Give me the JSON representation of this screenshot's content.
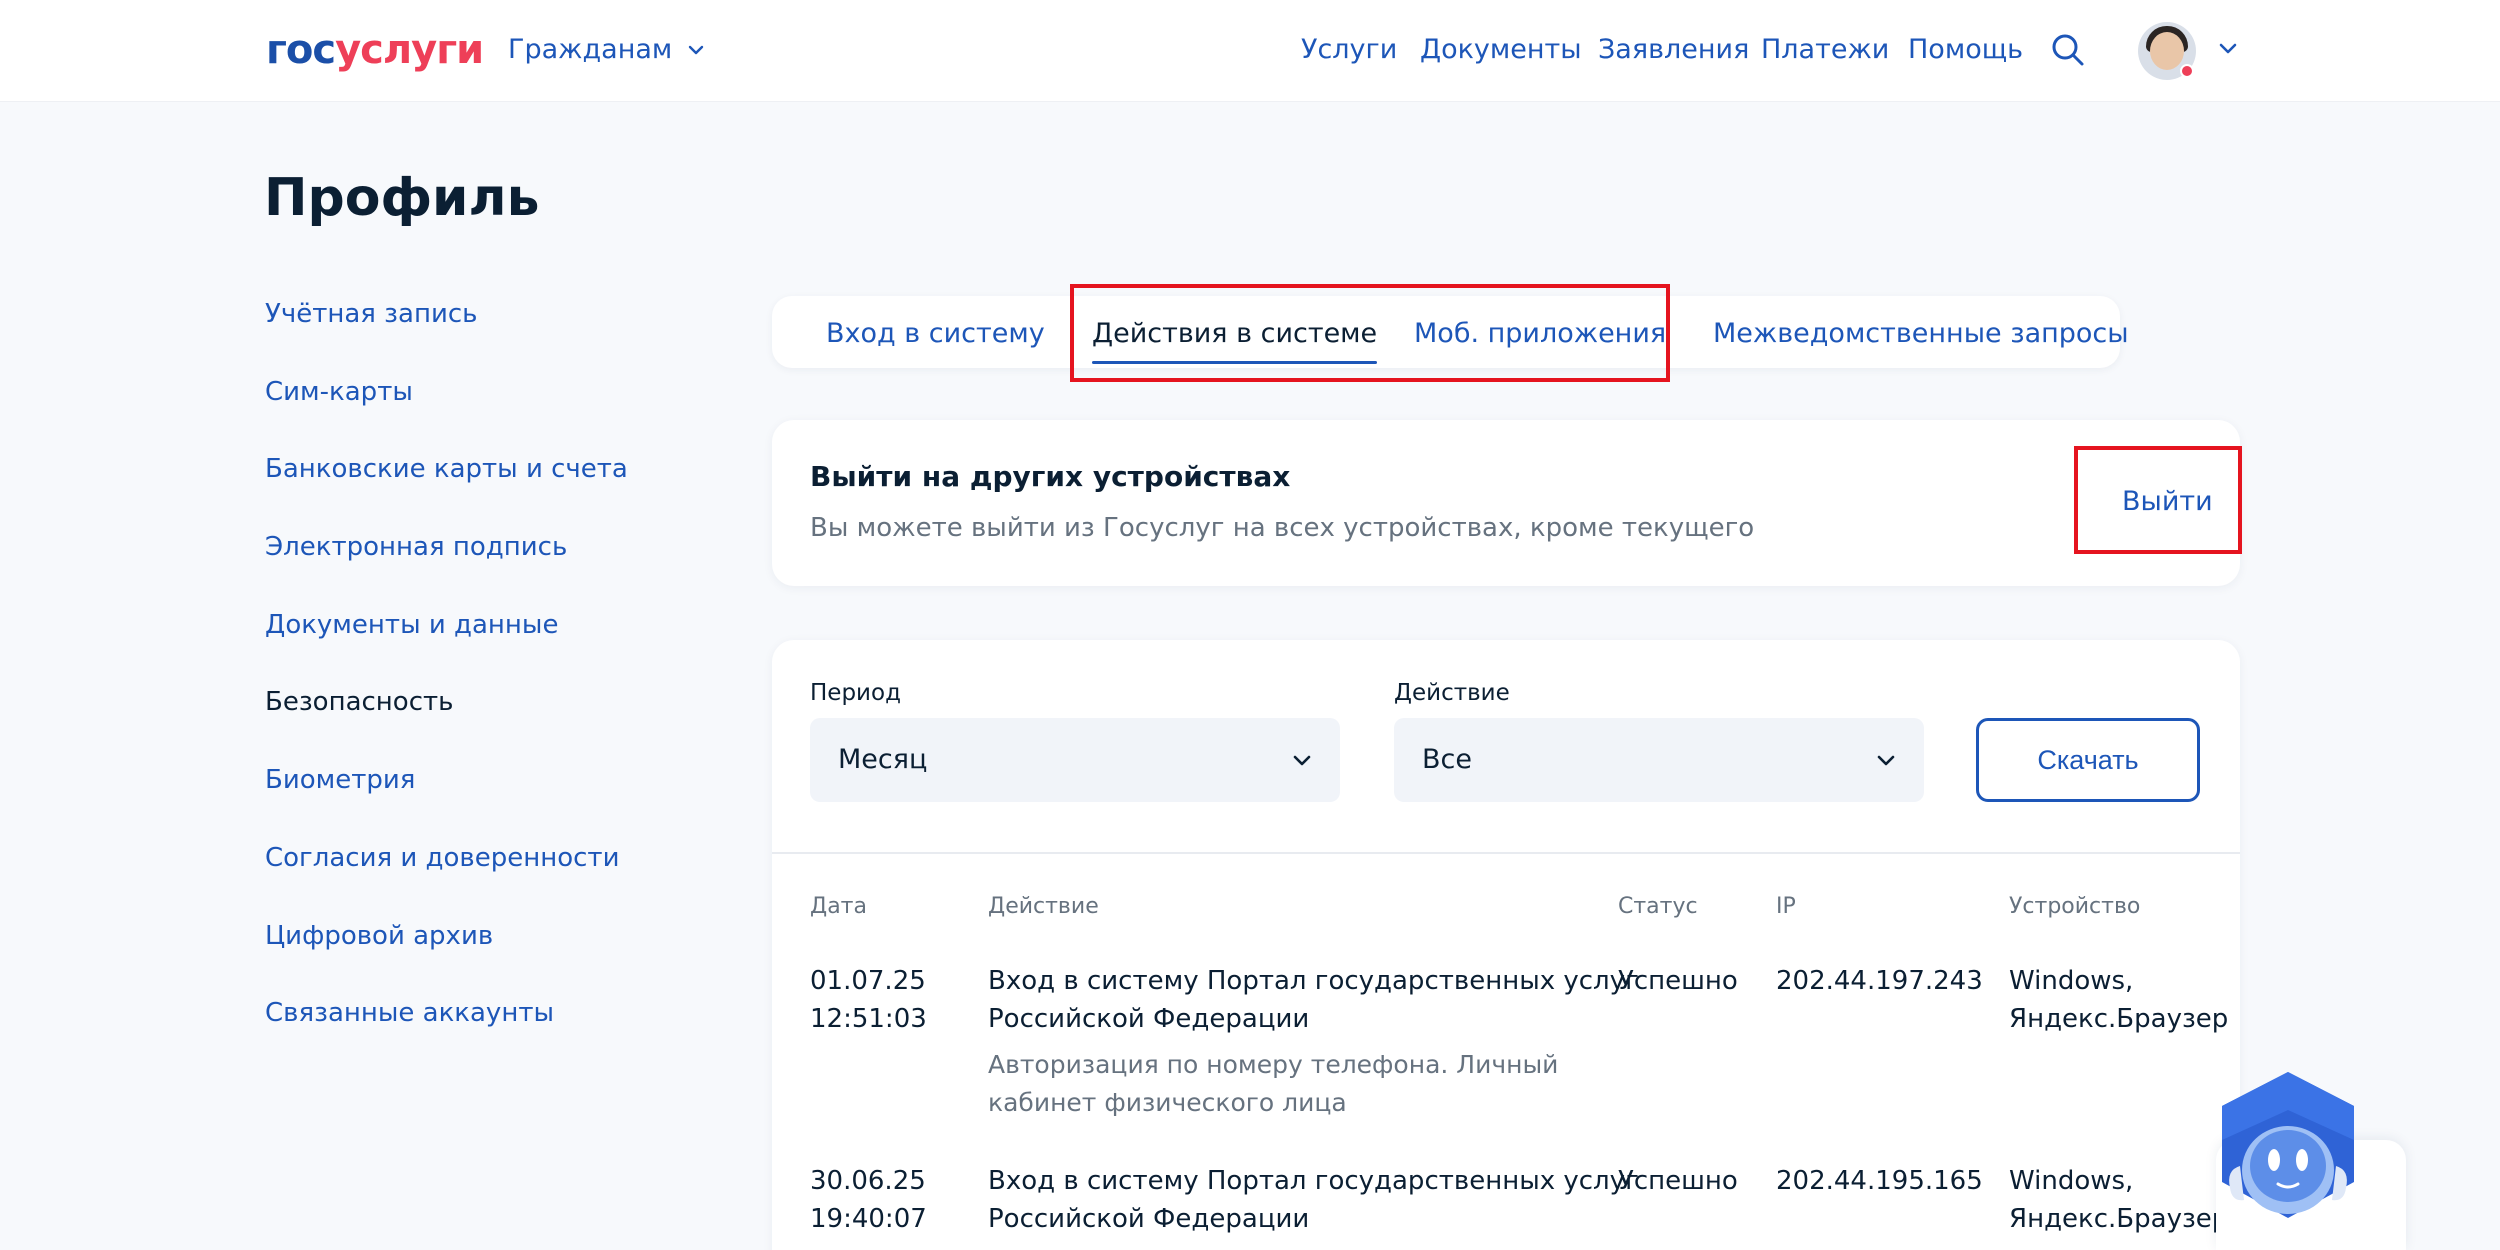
{
  "header": {
    "logo_blue": "гос",
    "logo_red": "услуги",
    "citizens_label": "Гражданам",
    "nav": [
      "Услуги",
      "Документы",
      "Заявления",
      "Платежи",
      "Помощь"
    ]
  },
  "page": {
    "title": "Профиль"
  },
  "sidebar": {
    "items": [
      "Учётная запись",
      "Сим-карты",
      "Банковские карты и счета",
      "Электронная подпись",
      "Документы и данные",
      "Безопасность",
      "Биометрия",
      "Согласия и доверенности",
      "Цифровой архив",
      "Связанные аккаунты"
    ],
    "active": "Безопасность"
  },
  "tabs": {
    "items": [
      "Вход в систему",
      "Действия в системе",
      "Моб. приложения",
      "Межведомственные запросы"
    ],
    "active": "Действия в системе"
  },
  "logout": {
    "title": "Выйти на других устройствах",
    "description": "Вы можете выйти из Госуслуг на всех устройствах, кроме текущего",
    "button": "Выйти"
  },
  "filters": {
    "period_label": "Период",
    "period_value": "Месяц",
    "action_label": "Действие",
    "action_value": "Все",
    "download": "Скачать"
  },
  "table": {
    "headers": [
      "Дата",
      "Действие",
      "Статус",
      "IP",
      "Устройство"
    ],
    "rows": [
      {
        "date": "01.07.25",
        "time": "12:51:03",
        "action_line1": "Вход в систему Портал государственных услуг",
        "action_line2": "Российской Федерации",
        "details_line1": "Авторизация по номеру телефона. Личный",
        "details_line2": "кабинет физического лица",
        "status": "Успешно",
        "ip": "202.44.197.243",
        "device_line1": "Windows,",
        "device_line2": "Яндекс.Браузер"
      },
      {
        "date": "30.06.25",
        "time": "19:40:07",
        "action_line1": "Вход в систему Портал государственных услуг",
        "action_line2": "Российской Федерации",
        "status": "Успешно",
        "ip": "202.44.195.165",
        "device_line1": "Windows,",
        "device_line2": "Яндекс.Браузер"
      }
    ]
  },
  "colors": {
    "link": "#1d56b8",
    "text": "#0b1f33",
    "muted": "#66727f",
    "highlight": "#e5141f",
    "brand_red": "#ee3f58"
  },
  "icons": [
    "chevron-down-icon",
    "search-icon",
    "avatar",
    "chat-bot-icon"
  ]
}
